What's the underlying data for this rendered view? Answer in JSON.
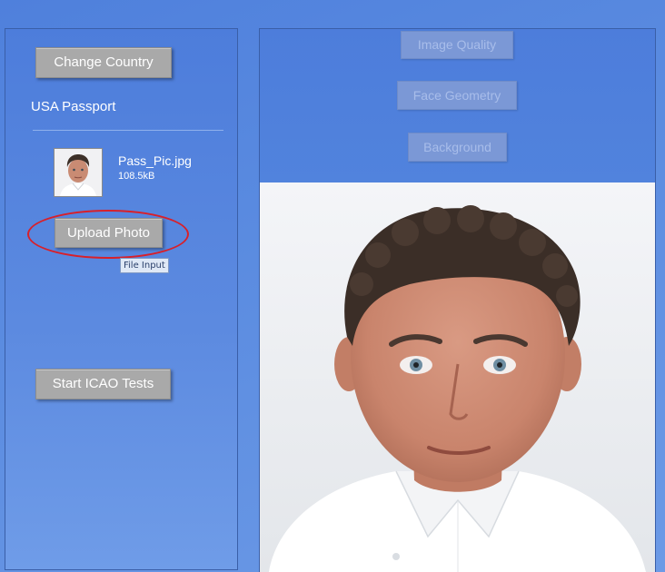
{
  "left_panel": {
    "change_country_label": "Change Country",
    "country_label": "USA Passport",
    "file": {
      "name": "Pass_Pic.jpg",
      "size": "108.5kB",
      "thumbnail_icon": "portrait-thumbnail"
    },
    "upload_label": "Upload Photo",
    "tooltip": "File Input",
    "start_tests_label": "Start ICAO Tests"
  },
  "right_panel": {
    "tabs": [
      {
        "label": "Image Quality"
      },
      {
        "label": "Face Geometry"
      },
      {
        "label": "Background"
      }
    ],
    "photo_icon": "passport-photo-portrait"
  },
  "colors": {
    "panel_blue": "#4f80dc",
    "button_gray": "#a9a9a9",
    "disabled_tab": "#7b98d6",
    "annotation_red": "#d8202a"
  }
}
